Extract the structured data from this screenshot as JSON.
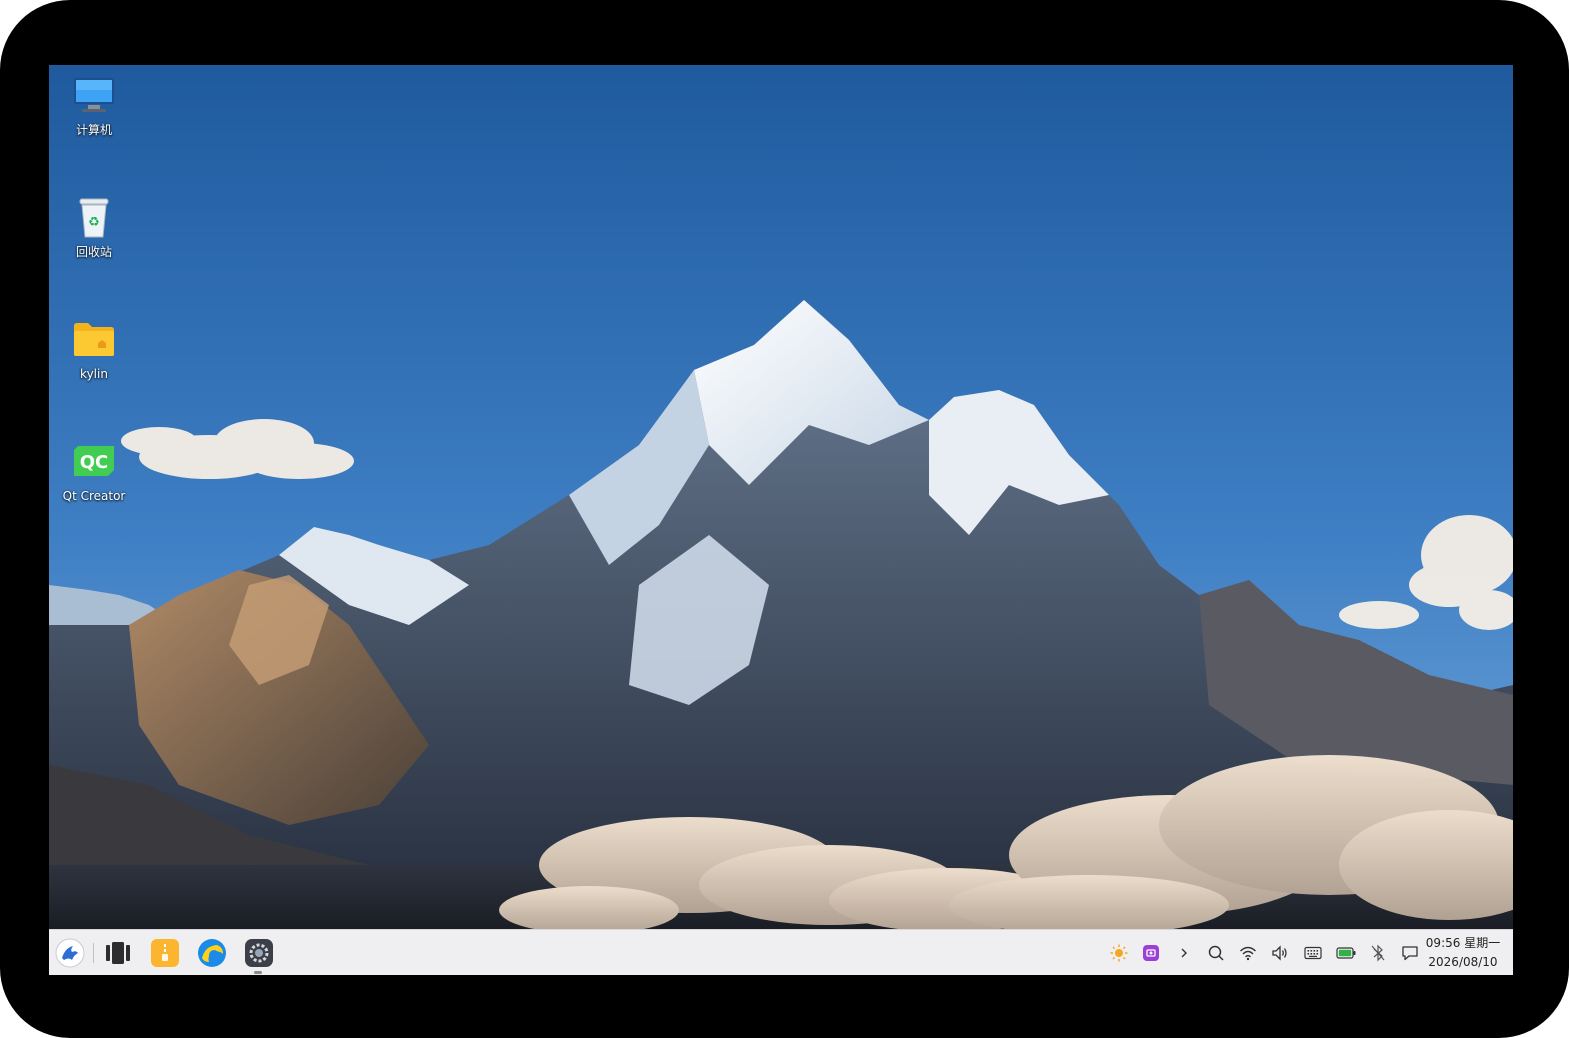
{
  "desktop": {
    "icons": [
      {
        "label": "计算机",
        "icon": "computer-icon"
      },
      {
        "label": "回收站",
        "icon": "trash-icon"
      },
      {
        "label": "kylin",
        "icon": "home-folder-icon"
      },
      {
        "label": "Qt Creator",
        "icon": "qt-creator-icon",
        "glyph_text": "QC"
      }
    ]
  },
  "taskbar": {
    "start_menu": {
      "icon": "kylin-start-icon"
    },
    "pinned": [
      {
        "icon": "multitask-view-icon"
      },
      {
        "icon": "file-manager-icon"
      },
      {
        "icon": "browser-icon"
      },
      {
        "icon": "settings-icon"
      }
    ],
    "tray": [
      {
        "icon": "brightness-icon",
        "color": "#f5a623"
      },
      {
        "icon": "screenshot-app-icon",
        "color": "#9b3fd6"
      },
      {
        "icon": "expand-tray-icon"
      },
      {
        "icon": "search-icon"
      },
      {
        "icon": "wifi-icon"
      },
      {
        "icon": "volume-icon"
      },
      {
        "icon": "keyboard-icon"
      },
      {
        "icon": "battery-icon",
        "color": "#2db34a"
      },
      {
        "icon": "bluetooth-off-icon"
      },
      {
        "icon": "notification-icon"
      }
    ],
    "clock": {
      "time_day": "09:56 星期一",
      "date": "2026/08/10"
    }
  },
  "colors": {
    "sky_top": "#1f5a9e",
    "sky_bottom": "#6da6dc",
    "taskbar_bg": "#efeff1",
    "bezel": "#000000"
  }
}
